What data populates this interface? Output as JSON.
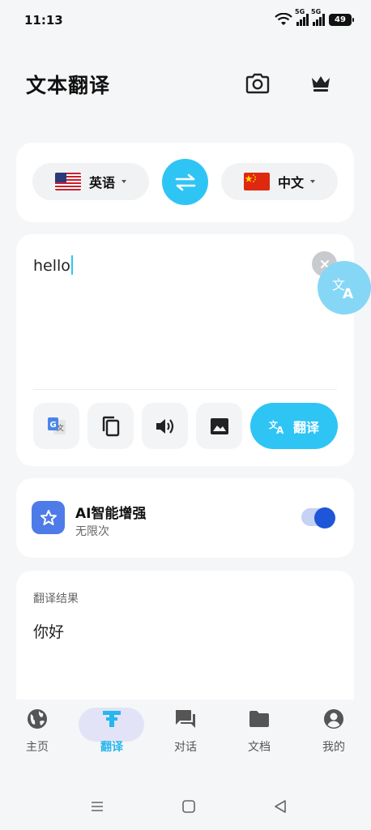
{
  "status_bar": {
    "time": "11:13",
    "signal_tag_1": "5G",
    "signal_tag_2": "5G",
    "battery": "49"
  },
  "header": {
    "title": "文本翻译",
    "camera_icon": "camera-icon",
    "vip_icon": "crown-icon"
  },
  "language_bar": {
    "source_label": "英语",
    "target_label": "中文",
    "source_flag": "us-flag-icon",
    "target_flag": "cn-flag-icon",
    "swap_icon": "swap-arrows-icon"
  },
  "input": {
    "text": "hello"
  },
  "tools": {
    "google_icon": "google-translate-icon",
    "copy_icon": "copy-icon",
    "speaker_icon": "speaker-icon",
    "image_icon": "image-icon",
    "translate_label": "翻译"
  },
  "ai": {
    "title": "AI智能增强",
    "subtitle": "无限次",
    "enabled": true
  },
  "result": {
    "label": "翻译结果",
    "text": "你好"
  },
  "nav": {
    "items": [
      {
        "label": "主页",
        "icon": "globe-icon"
      },
      {
        "label": "翻译",
        "icon": "translate-t-icon",
        "active": true
      },
      {
        "label": "对话",
        "icon": "chat-icon"
      },
      {
        "label": "文档",
        "icon": "folder-icon"
      },
      {
        "label": "我的",
        "icon": "profile-icon"
      }
    ]
  },
  "colors": {
    "accent": "#2ec5f5",
    "ai_blue": "#4f7be8",
    "toggle_on": "#1f55d8",
    "nav_active": "#27b6ee"
  }
}
